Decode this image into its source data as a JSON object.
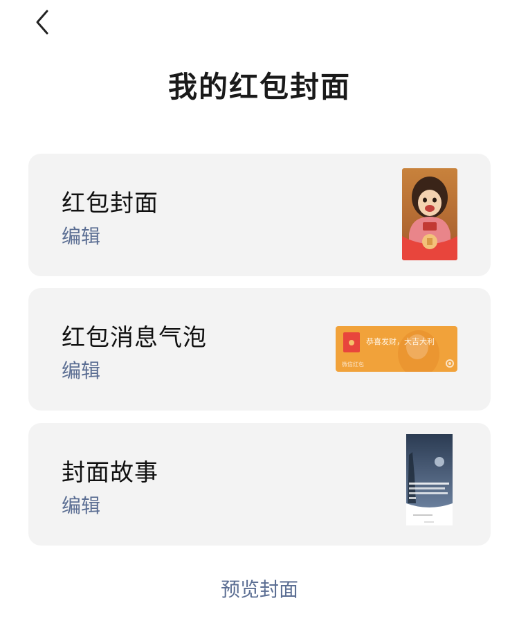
{
  "page": {
    "title": "我的红包封面"
  },
  "cards": [
    {
      "title": "红包封面",
      "edit_label": "编辑"
    },
    {
      "title": "红包消息气泡",
      "edit_label": "编辑",
      "bubble_text": "恭喜发财，大吉大利",
      "bubble_sub": "微信红包"
    },
    {
      "title": "封面故事",
      "edit_label": "编辑"
    }
  ],
  "footer": {
    "preview_label": "预览封面"
  },
  "colors": {
    "link": "#5b6e93",
    "card_bg": "#f3f3f3",
    "red": "#e8453c",
    "orange": "#f1a23a"
  },
  "icons": {
    "back": "chevron-left-icon"
  }
}
